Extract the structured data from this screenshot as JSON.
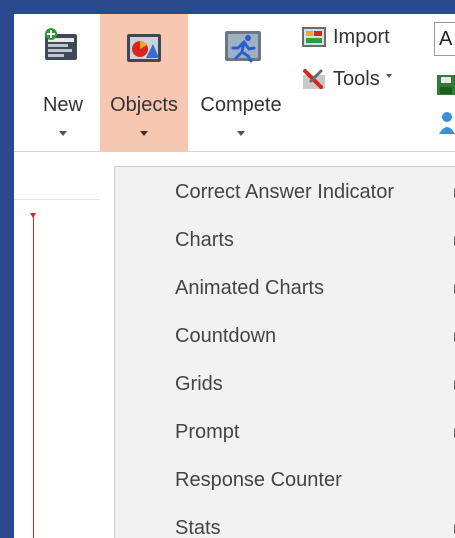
{
  "ribbon": {
    "new_label": "New",
    "objects_label": "Objects",
    "compete_label": "Compete",
    "import_label": "Import",
    "tools_label": "Tools",
    "combo_value": "A"
  },
  "menu": {
    "items": [
      {
        "label": "Correct Answer Indicator",
        "has_submenu": true
      },
      {
        "label": "Charts",
        "has_submenu": true
      },
      {
        "label": "Animated Charts",
        "has_submenu": true
      },
      {
        "label": "Countdown",
        "has_submenu": true
      },
      {
        "label": "Grids",
        "has_submenu": true
      },
      {
        "label": "Prompt",
        "has_submenu": true
      },
      {
        "label": "Response Counter",
        "has_submenu": false
      },
      {
        "label": "Stats",
        "has_submenu": true
      }
    ]
  },
  "colors": {
    "objects_active": "#f8c7b2",
    "menu_background": "#f2f2f2",
    "window_border": "#2b4a8e",
    "timeline_red": "#d9261c"
  },
  "icons": [
    "new-slide-icon",
    "objects-icon",
    "compete-runner-icon",
    "import-icon",
    "tools-icon"
  ]
}
